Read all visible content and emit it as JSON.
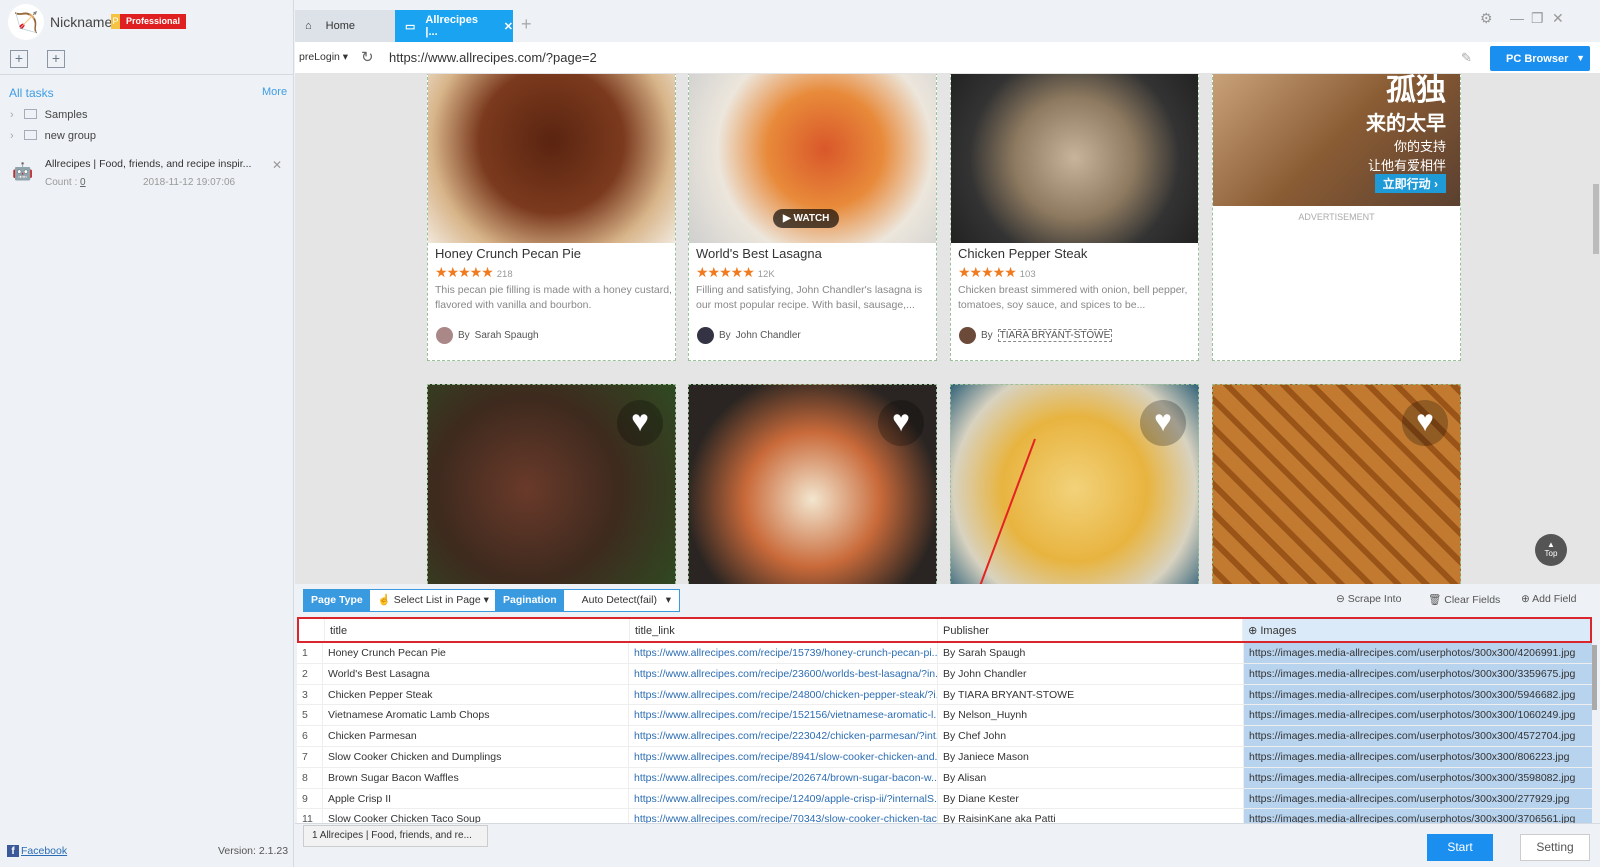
{
  "user": {
    "nickname": "Nickname",
    "badge_p": "P",
    "badge": "Professional"
  },
  "sidebar": {
    "all_tasks": "All tasks",
    "more": "More",
    "groups": [
      {
        "label": "Samples"
      },
      {
        "label": "new group"
      }
    ],
    "task": {
      "title": "Allrecipes | Food, friends, and recipe inspir...",
      "count_label": "Count :",
      "count": "0",
      "date": "2018-11-12 19:07:06"
    },
    "facebook": "Facebook",
    "version": "Version: 2.1.23"
  },
  "tabs": [
    {
      "label": "Home"
    },
    {
      "label": "Allrecipes |..."
    }
  ],
  "address": {
    "mode": "preLogin",
    "url": "https://www.allrecipes.com/?page=2",
    "browser": "PC Browser"
  },
  "cards": [
    {
      "title": "Honey Crunch Pecan Pie",
      "rating": 4.5,
      "stars": "★★★★★",
      "count": "218",
      "desc": "This pecan pie filling is made with a honey custard, flavored with vanilla and bourbon.",
      "author_prefix": "By",
      "author": "Sarah Spaugh"
    },
    {
      "title": "World's Best Lasagna",
      "rating": 5,
      "stars": "★★★★★",
      "count": "12K",
      "desc": "Filling and satisfying, John Chandler's lasagna is our most popular recipe. With basil, sausage,...",
      "author_prefix": "By",
      "author": "John Chandler",
      "watch": "WATCH"
    },
    {
      "title": "Chicken Pepper Steak",
      "rating": 4.5,
      "stars": "★★★★★",
      "count": "103",
      "desc": "Chicken breast simmered with onion, bell pepper, tomatoes, soy sauce, and spices to be...",
      "author_prefix": "By",
      "author": "TIARA BRYANT-STOWE"
    }
  ],
  "ad": {
    "line1": "孤独",
    "line2": "来的太早",
    "line3": "你的支持",
    "line4": "让他有爱相伴",
    "cta": "立即行动 ›",
    "label": "ADVERTISEMENT"
  },
  "top_button": "Top",
  "toolbar": {
    "page_type_label": "Page Type",
    "page_type_value": "Select List in Page",
    "pagination_label": "Pagination",
    "pagination_value": "Auto Detect(fail)",
    "scrape_into": "Scrape Into",
    "clear_fields": "Clear Fields",
    "add_field": "Add Field"
  },
  "table": {
    "columns": [
      "title",
      "title_link",
      "Publisher",
      "Images"
    ],
    "rows": [
      [
        "1",
        "Honey Crunch Pecan Pie",
        "https://www.allrecipes.com/recipe/15739/honey-crunch-pecan-pi...",
        "By Sarah Spaugh",
        "https://images.media-allrecipes.com/userphotos/300x300/4206991.jpg"
      ],
      [
        "2",
        "World's Best Lasagna",
        "https://www.allrecipes.com/recipe/23600/worlds-best-lasagna/?in...",
        "By John Chandler",
        "https://images.media-allrecipes.com/userphotos/300x300/3359675.jpg"
      ],
      [
        "3",
        "Chicken Pepper Steak",
        "https://www.allrecipes.com/recipe/24800/chicken-pepper-steak/?i...",
        "By TIARA BRYANT-STOWE",
        "https://images.media-allrecipes.com/userphotos/300x300/5946682.jpg"
      ],
      [
        "5",
        "Vietnamese Aromatic Lamb Chops",
        "https://www.allrecipes.com/recipe/152156/vietnamese-aromatic-l...",
        "By Nelson_Huynh",
        "https://images.media-allrecipes.com/userphotos/300x300/1060249.jpg"
      ],
      [
        "6",
        "Chicken Parmesan",
        "https://www.allrecipes.com/recipe/223042/chicken-parmesan/?int...",
        "By Chef John",
        "https://images.media-allrecipes.com/userphotos/300x300/4572704.jpg"
      ],
      [
        "7",
        "Slow Cooker Chicken and Dumplings",
        "https://www.allrecipes.com/recipe/8941/slow-cooker-chicken-and...",
        "By Janiece Mason",
        "https://images.media-allrecipes.com/userphotos/300x300/806223.jpg"
      ],
      [
        "8",
        "Brown Sugar Bacon Waffles",
        "https://www.allrecipes.com/recipe/202674/brown-sugar-bacon-w...",
        "By Alisan",
        "https://images.media-allrecipes.com/userphotos/300x300/3598082.jpg"
      ],
      [
        "9",
        "Apple Crisp II",
        "https://www.allrecipes.com/recipe/12409/apple-crisp-ii/?internalS...",
        "By Diane Kester",
        "https://images.media-allrecipes.com/userphotos/300x300/277929.jpg"
      ],
      [
        "11",
        "Slow Cooker Chicken Taco Soup",
        "https://www.allrecipes.com/recipe/70343/slow-cooker-chicken-tac...",
        "By RaisinKane aka Patti",
        "https://images.media-allrecipes.com/userphotos/300x300/3706561.jpg"
      ]
    ]
  },
  "bottom": {
    "task_tab": "1 Allrecipes | Food, friends, and re...",
    "start": "Start",
    "setting": "Setting"
  },
  "colors": {
    "accent": "#1a8ff0",
    "tab_active": "#1aa3f0",
    "highlight_border": "#d9262c",
    "star": "#f07a1d"
  }
}
